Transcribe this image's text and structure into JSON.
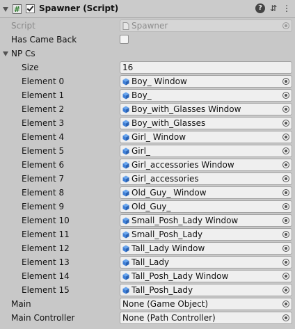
{
  "header": {
    "title": "Spawner (Script)",
    "script_icon_glyph": "#",
    "icons": [
      "foldout-arrow-icon",
      "script-icon",
      "enabled-checkbox",
      "help-icon",
      "preset-icon",
      "more-icon"
    ]
  },
  "script": {
    "label": "Script",
    "value": "Spawner"
  },
  "has_came_back": {
    "label": "Has Came Back",
    "checked": false
  },
  "npcs": {
    "label": "NP Cs",
    "size_label": "Size",
    "size_value": "16",
    "elements": [
      {
        "label": "Element 0",
        "value": "Boy_ Window"
      },
      {
        "label": "Element 1",
        "value": "Boy_"
      },
      {
        "label": "Element 2",
        "value": "Boy_with_Glasses Window"
      },
      {
        "label": "Element 3",
        "value": "Boy_with_Glasses"
      },
      {
        "label": "Element 4",
        "value": "Girl_ Window"
      },
      {
        "label": "Element 5",
        "value": "Girl_"
      },
      {
        "label": "Element 6",
        "value": "Girl_accessories Window"
      },
      {
        "label": "Element 7",
        "value": "Girl_accessories"
      },
      {
        "label": "Element 8",
        "value": "Old_Guy_ Window"
      },
      {
        "label": "Element 9",
        "value": "Old_Guy_"
      },
      {
        "label": "Element 10",
        "value": "Small_Posh_Lady Window"
      },
      {
        "label": "Element 11",
        "value": "Small_Posh_Lady"
      },
      {
        "label": "Element 12",
        "value": "Tall_Lady Window"
      },
      {
        "label": "Element 13",
        "value": "Tall_Lady"
      },
      {
        "label": "Element 14",
        "value": "Tall_Posh_Lady Window"
      },
      {
        "label": "Element 15",
        "value": "Tall_Posh_Lady"
      }
    ]
  },
  "main": {
    "label": "Main",
    "value": "None (Game Object)"
  },
  "main_controller": {
    "label": "Main Controller",
    "value": "None (Path Controller)"
  },
  "colors": {
    "panel_bg": "#c8c8c8",
    "field_bg": "#efefef",
    "prefab_icon": "#3f7fd6",
    "disabled_text": "#8a8a8a"
  }
}
